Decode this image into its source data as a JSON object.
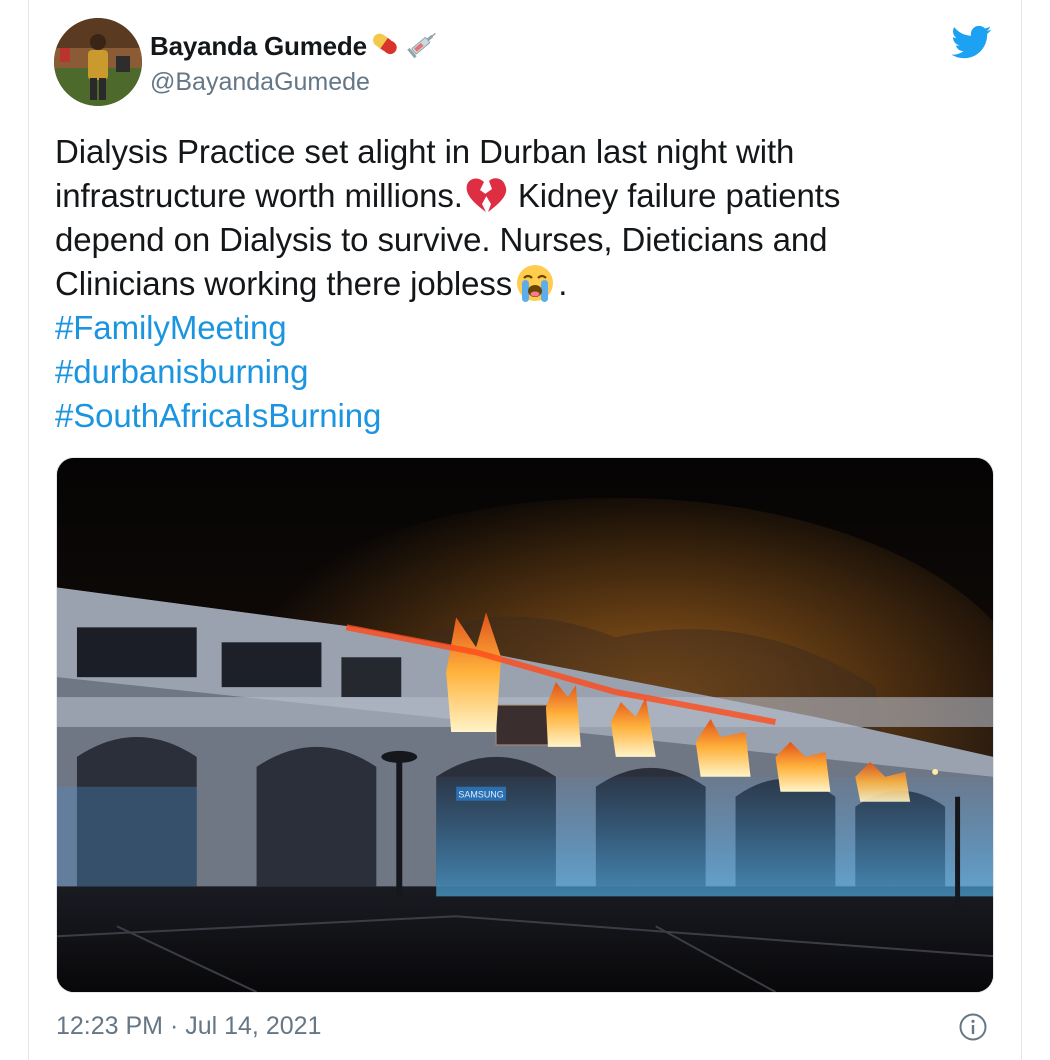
{
  "author": {
    "display_name": "Bayanda Gumede",
    "name_emojis": [
      "pill-icon",
      "syringe-icon"
    ],
    "handle": "@BayandaGumede"
  },
  "tweet": {
    "lines": [
      "Dialysis Practice set alight in Durban last night with",
      "infrastructure worth millions.",
      " Kidney failure patients",
      "depend on Dialysis to survive. Nurses, Dieticians and",
      "Clinicians working there jobless",
      "."
    ],
    "inline_emojis": [
      "broken-heart-icon",
      "loudly-crying-face-icon"
    ],
    "hashtags": [
      "#FamilyMeeting",
      "#durbanisburning",
      "#SouthAfricaIsBurning"
    ]
  },
  "media": {
    "icon": "photo-of-burning-building",
    "sign_text": "SAMSUNG"
  },
  "timestamp": "12:23 PM · Jul 14, 2021",
  "colors": {
    "hashtag": "#1b95e0",
    "twitter_blue": "#1da1f2",
    "secondary_text": "#657786"
  },
  "icons": {
    "brand": "twitter-bird-icon",
    "info": "info-icon"
  }
}
